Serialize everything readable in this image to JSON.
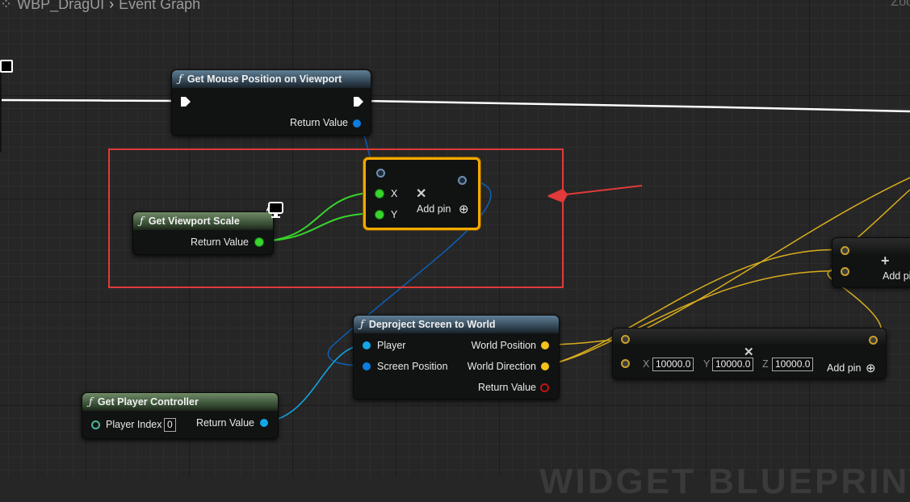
{
  "breadcrumb": {
    "asset": "WBP_DragUI",
    "graph": "Event Graph",
    "zoom": "Zoo"
  },
  "watermark": "WIDGET BLUEPRINT",
  "nodes": {
    "mouse_pos": {
      "title": "Get Mouse Position on Viewport",
      "return_label": "Return Value"
    },
    "viewport_scale": {
      "title": "Get Viewport Scale",
      "return_label": "Return Value"
    },
    "make_vector2d": {
      "x_label": "X",
      "y_label": "Y",
      "add_pin": "Add pin"
    },
    "deproject": {
      "title": "Deproject Screen to World",
      "player": "Player",
      "screen_pos": "Screen Position",
      "world_pos": "World Position",
      "world_dir": "World Direction",
      "return_label": "Return Value"
    },
    "player_controller": {
      "title": "Get Player Controller",
      "player_index": "Player Index",
      "player_index_value": "0",
      "return_label": "Return Value"
    },
    "make_vector": {
      "x": "X",
      "y": "Y",
      "z": "Z",
      "x_value": "10000.0",
      "y_value": "10000.0",
      "z_value": "10000.0",
      "add_pin": "Add pin"
    },
    "add_node": {
      "add_pin": "Add pi"
    }
  },
  "colors": {
    "highlight_border": "#e03a3a",
    "exec_wire": "#ffffff",
    "float_wire": "#37d52d",
    "struct_wire": "#0d7de0",
    "vector_wire": "#f4c21b"
  }
}
